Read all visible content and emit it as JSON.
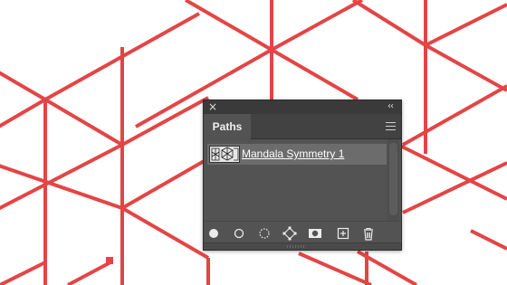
{
  "canvas": {
    "background_color": "#ffffff",
    "line_color": "#e34545"
  },
  "panel": {
    "close_icon": "×",
    "collapse_icon": "‹‹",
    "tab_label": "Paths",
    "menu_icon": "panel-menu-icon",
    "paths": [
      {
        "name": "Mandala Symmetry 1"
      }
    ],
    "toolbar": [
      {
        "name": "fill-path-icon",
        "tooltip": "Fill path with foreground color"
      },
      {
        "name": "stroke-path-icon",
        "tooltip": "Stroke path with brush"
      },
      {
        "name": "load-selection-icon",
        "tooltip": "Load path as a selection"
      },
      {
        "name": "make-work-path-icon",
        "tooltip": "Make work path from selection"
      },
      {
        "name": "add-mask-icon",
        "tooltip": "Add a mask"
      },
      {
        "name": "new-path-icon",
        "tooltip": "Create new path"
      },
      {
        "name": "trash-icon",
        "tooltip": "Delete current path"
      }
    ]
  }
}
